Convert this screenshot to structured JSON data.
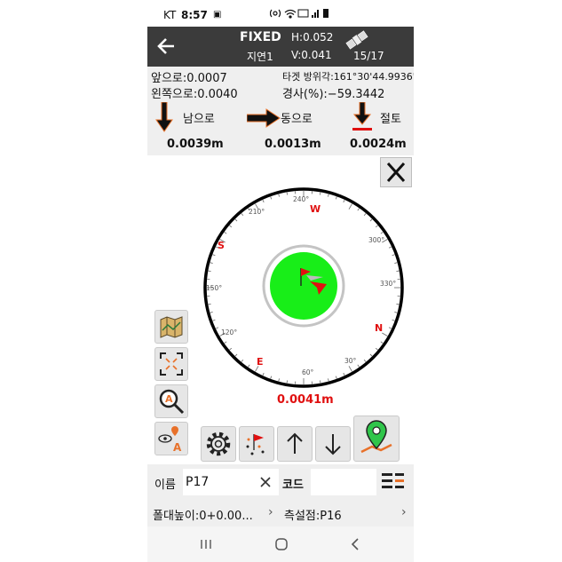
{
  "status": {
    "carrier": "KT",
    "time": "8:57"
  },
  "appbar": {
    "fix": "FIXED",
    "h": "H:0.052",
    "delay": "지연1",
    "v": "V:0.041",
    "sats": "15/17"
  },
  "info": {
    "forward": "앞으로:0.0007",
    "left": "왼쪽으로:0.0040",
    "bearing": "타겟 방위각:161°30'44.9936\"",
    "slope": "경사(%):−59.3442"
  },
  "directions": [
    {
      "label": "남으로",
      "value": "0.0039m"
    },
    {
      "label": "동으로",
      "value": "0.0013m"
    },
    {
      "label": "절토",
      "value": "0.0024m"
    }
  ],
  "compass": {
    "letters": [
      "W",
      "S",
      "N",
      "E"
    ],
    "degrees": [
      "240°",
      "210°",
      "300°",
      "150°",
      "330°",
      "120°",
      "30°",
      "60°"
    ],
    "distance": "0.0041m"
  },
  "name_bar": {
    "name_label": "이름",
    "name_value": "P17",
    "code_label": "코드",
    "code_value": ""
  },
  "point_bar": {
    "pole_height": "폴대높이:0+0.00...",
    "station": "측설점:P16"
  },
  "colors": {
    "appbar": "#3b3b3b",
    "target_green": "#18ee18",
    "accent_red": "#e01010",
    "arrow_orange": "#e8712a"
  }
}
